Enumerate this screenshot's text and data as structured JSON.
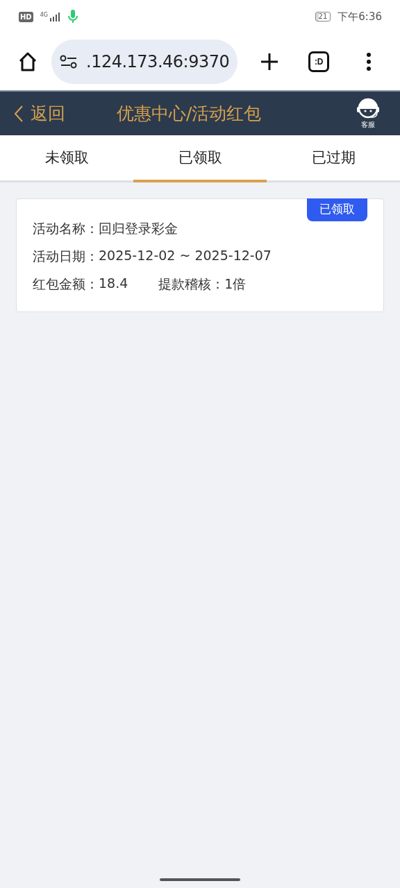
{
  "status_bar": {
    "hd": "HD",
    "network": "4G",
    "battery": "21",
    "time": "下午6:36"
  },
  "browser": {
    "url": ".124.173.46:9370",
    "tabs_label": ":D"
  },
  "header": {
    "back": "返回",
    "title": "优惠中心/活动红包",
    "support": "客服"
  },
  "tabs": [
    {
      "label": "未领取",
      "selected": false
    },
    {
      "label": "已领取",
      "selected": true
    },
    {
      "label": "已过期",
      "selected": false
    }
  ],
  "cards": [
    {
      "badge": "已领取",
      "rows": [
        {
          "fields": [
            {
              "label": "活动名称：",
              "value": "回归登录彩金"
            }
          ]
        },
        {
          "fields": [
            {
              "label": "活动日期：",
              "value": "2025-12-02 ~ 2025-12-07"
            }
          ]
        },
        {
          "fields": [
            {
              "label": "红包金额：",
              "value": "18.4"
            },
            {
              "label": "提款稽核：",
              "value": "1倍"
            }
          ]
        }
      ]
    }
  ]
}
